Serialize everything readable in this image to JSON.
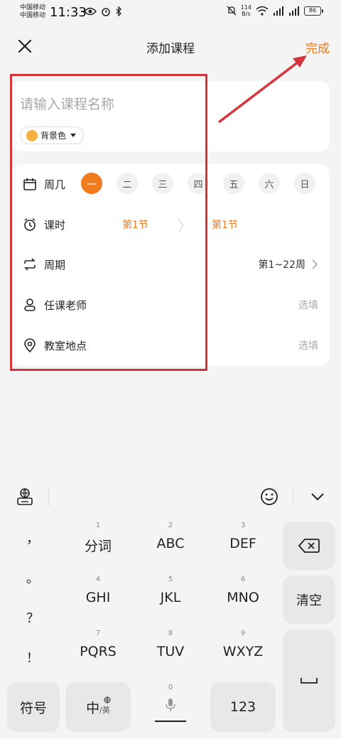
{
  "status": {
    "carrier1": "中国移动",
    "carrier2": "中国移动",
    "time": "11:33",
    "speed_value": "114",
    "speed_unit": "B/s",
    "battery": "86"
  },
  "header": {
    "title": "添加课程",
    "done_label": "完成"
  },
  "course": {
    "name_placeholder": "请输入课程名称",
    "bg_color_label": "背景色",
    "bg_color": "#f5b041"
  },
  "weekday": {
    "label": "周几",
    "days": [
      "一",
      "二",
      "三",
      "四",
      "五",
      "六",
      "日"
    ],
    "selected": "一"
  },
  "period": {
    "label": "课时",
    "start": "第1节",
    "end": "第1节"
  },
  "weeks": {
    "label": "周期",
    "value": "第1~22周"
  },
  "teacher": {
    "label": "任课老师",
    "placeholder": "选填"
  },
  "location": {
    "label": "教室地点",
    "placeholder": "选填"
  },
  "keyboard": {
    "punct": [
      "，",
      "。",
      "？",
      "！"
    ],
    "keys": [
      {
        "num": "1",
        "label": "分词"
      },
      {
        "num": "2",
        "label": "ABC"
      },
      {
        "num": "3",
        "label": "DEF"
      },
      {
        "num": "4",
        "label": "GHI"
      },
      {
        "num": "5",
        "label": "JKL"
      },
      {
        "num": "6",
        "label": "MNO"
      },
      {
        "num": "7",
        "label": "PQRS"
      },
      {
        "num": "8",
        "label": "TUV"
      },
      {
        "num": "9",
        "label": "WXYZ"
      }
    ],
    "clear_label": "清空",
    "symbols_label": "符号",
    "lang_main": "中",
    "lang_sub": "/英",
    "space_num": "0",
    "numbers_label": "123"
  },
  "colors": {
    "accent": "#f07c1e",
    "annotation": "#d8343c"
  }
}
